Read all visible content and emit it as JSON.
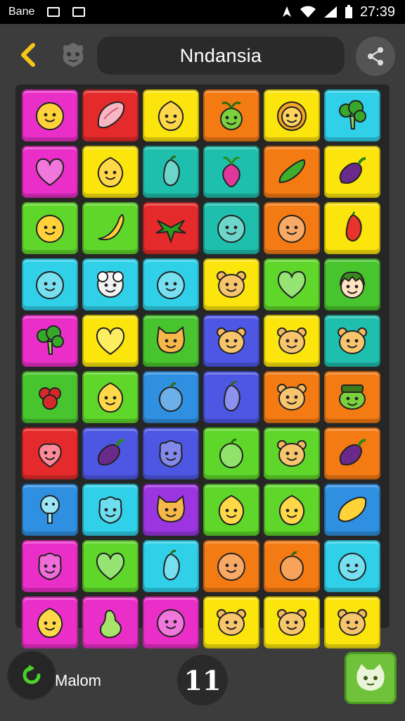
{
  "status": {
    "carrier": "Bane",
    "time": "27:39"
  },
  "header": {
    "title": "Nndansia"
  },
  "footer": {
    "mode_label": "Malom",
    "moves": "11"
  },
  "colors": {
    "magenta": "#ea2fc9",
    "red": "#e42a2a",
    "yellow": "#fbe50c",
    "orange": "#f47b14",
    "cyan": "#2fd0e8",
    "green": "#5fd62a",
    "teal": "#1fbfae",
    "blue": "#2f8fe0",
    "purple": "#9a35e0",
    "indigo": "#4d57e3",
    "lime": "#48c42e",
    "accent": "#f5c518"
  },
  "board": {
    "rows": [
      [
        {
          "color": "magenta",
          "icon": "smiley-face-icon"
        },
        {
          "color": "red",
          "icon": "radish-icon"
        },
        {
          "color": "yellow",
          "icon": "lemon-face-icon"
        },
        {
          "color": "orange",
          "icon": "sprout-creature-icon"
        },
        {
          "color": "yellow",
          "icon": "lion-face-icon"
        },
        {
          "color": "cyan",
          "icon": "broccoli-icon"
        }
      ],
      [
        {
          "color": "magenta",
          "icon": "heart-icon"
        },
        {
          "color": "yellow",
          "icon": "lemon-face-icon"
        },
        {
          "color": "teal",
          "icon": "pepper-icon"
        },
        {
          "color": "teal",
          "icon": "beet-icon"
        },
        {
          "color": "orange",
          "icon": "cucumber-icon"
        },
        {
          "color": "yellow",
          "icon": "eggplant-icon"
        }
      ],
      [
        {
          "color": "green",
          "icon": "smiley-face-icon"
        },
        {
          "color": "green",
          "icon": "banana-icon"
        },
        {
          "color": "red",
          "icon": "leaf-bunch-icon"
        },
        {
          "color": "teal",
          "icon": "ball-face-icon"
        },
        {
          "color": "orange",
          "icon": "ball-face-icon"
        },
        {
          "color": "yellow",
          "icon": "chili-icon"
        }
      ],
      [
        {
          "color": "cyan",
          "icon": "ball-face-icon"
        },
        {
          "color": "cyan",
          "icon": "sheep-face-icon"
        },
        {
          "color": "cyan",
          "icon": "ball-face-icon"
        },
        {
          "color": "yellow",
          "icon": "bear-face-icon"
        },
        {
          "color": "green",
          "icon": "heart-icon"
        },
        {
          "color": "lime",
          "icon": "kid-face-icon"
        }
      ],
      [
        {
          "color": "magenta",
          "icon": "broccoli-icon"
        },
        {
          "color": "yellow",
          "icon": "heart-icon"
        },
        {
          "color": "lime",
          "icon": "cat-face-icon"
        },
        {
          "color": "indigo",
          "icon": "bear-face-icon"
        },
        {
          "color": "yellow",
          "icon": "bear-face-icon"
        },
        {
          "color": "teal",
          "icon": "bear-face-icon"
        }
      ],
      [
        {
          "color": "lime",
          "icon": "raspberry-icon"
        },
        {
          "color": "green",
          "icon": "lemon-face-icon"
        },
        {
          "color": "blue",
          "icon": "plum-icon"
        },
        {
          "color": "indigo",
          "icon": "pepper-icon"
        },
        {
          "color": "orange",
          "icon": "bear-face-icon"
        },
        {
          "color": "orange",
          "icon": "frog-face-icon"
        }
      ],
      [
        {
          "color": "red",
          "icon": "strawberry-icon"
        },
        {
          "color": "indigo",
          "icon": "eggplant-icon"
        },
        {
          "color": "indigo",
          "icon": "berry-face-icon"
        },
        {
          "color": "green",
          "icon": "plum-icon"
        },
        {
          "color": "green",
          "icon": "bear-face-icon"
        },
        {
          "color": "orange",
          "icon": "eggplant-icon"
        }
      ],
      [
        {
          "color": "blue",
          "icon": "tree-icon"
        },
        {
          "color": "cyan",
          "icon": "berry-face-icon"
        },
        {
          "color": "purple",
          "icon": "cat-face-icon"
        },
        {
          "color": "green",
          "icon": "lemon-face-icon"
        },
        {
          "color": "green",
          "icon": "lemon-face-icon"
        },
        {
          "color": "blue",
          "icon": "lemon-icon"
        }
      ],
      [
        {
          "color": "magenta",
          "icon": "berry-face-icon"
        },
        {
          "color": "green",
          "icon": "heart-icon"
        },
        {
          "color": "cyan",
          "icon": "pepper-icon"
        },
        {
          "color": "orange",
          "icon": "ball-face-icon"
        },
        {
          "color": "orange",
          "icon": "plum-icon"
        },
        {
          "color": "cyan",
          "icon": "ball-face-icon"
        }
      ],
      [
        {
          "color": "magenta",
          "icon": "lemon-face-icon"
        },
        {
          "color": "magenta",
          "icon": "pear-icon"
        },
        {
          "color": "magenta",
          "icon": "ball-face-icon"
        },
        {
          "color": "yellow",
          "icon": "bear-face-icon"
        },
        {
          "color": "yellow",
          "icon": "bear-face-icon"
        },
        {
          "color": "yellow",
          "icon": "bear-face-icon"
        }
      ]
    ]
  }
}
